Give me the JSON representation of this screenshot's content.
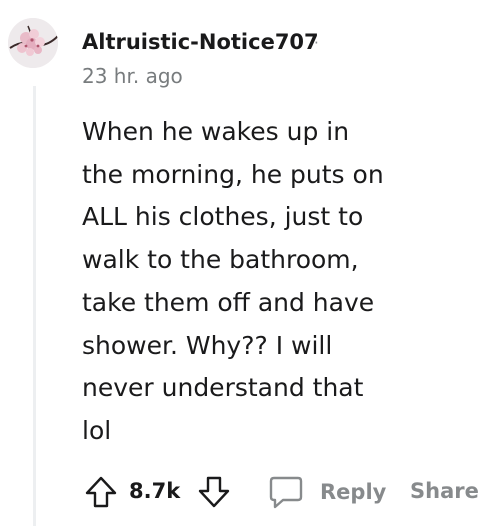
{
  "comment": {
    "author": "Altruistic-Notice707",
    "separator": "·",
    "timestamp": "23 hr. ago",
    "avatar_icon": "cherry-blossom-avatar",
    "body_lines": [
      "When he wakes up in",
      "the morning, he puts on",
      "ALL his clothes, just to",
      "walk to the bathroom,",
      "take them off and have",
      "shower. Why?? I will",
      "never understand that",
      "lol"
    ]
  },
  "actions": {
    "upvote_icon": "upvote-arrow-icon",
    "score": "8.7k",
    "downvote_icon": "downvote-arrow-icon",
    "reply_icon": "comment-bubble-icon",
    "reply_label": "Reply",
    "share_label": "Share"
  },
  "colors": {
    "text": "#1a1a1b",
    "meta": "#787c7e",
    "action": "#878a8c",
    "thread_line": "#edeff1"
  }
}
